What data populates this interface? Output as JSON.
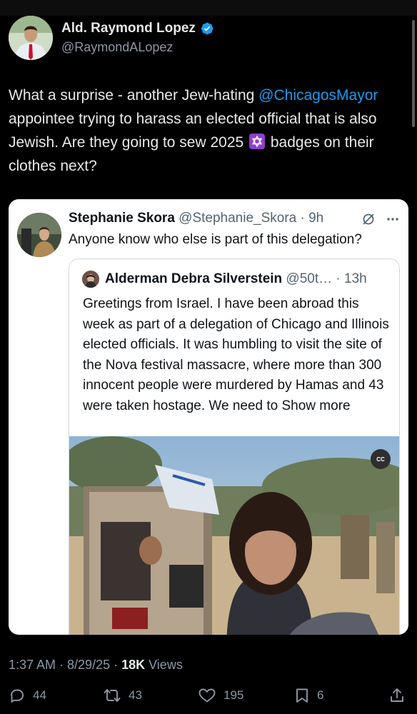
{
  "tweet": {
    "author": {
      "display_name": "Ald. Raymond Lopez",
      "handle": "@RaymondALopez",
      "verified": true
    },
    "text_before": "What a surprise - another Jew-hating ",
    "mention": "@ChicagosMayor",
    "text_after": " appointee trying to harass an elected official that is also Jewish. Are they going to sew 2025 ",
    "emoji": "star-of-david-emoji",
    "text_end": " badges on their clothes next?",
    "timestamp": "1:37 AM · 8/29/25 · ",
    "views_count": "18K",
    "views_label": " Views"
  },
  "quote": {
    "display_name": "Stephanie Skora",
    "meta": " @Stephanie_Skora · 9h",
    "text": "Anyone know who else is part of this delegation?",
    "nested": {
      "display_name": "Alderman Debra Silverstein",
      "meta": " @50t… · 13h",
      "text": "Greetings from Israel. I have been abroad this week as part of a delegation of Chicago and Illinois elected officials. It was humbling to visit the site of the Nova festival massacre, where more than 300 innocent people were murdered by Hamas and 43 were taken hostage. We need to ",
      "show_more": "Show more",
      "video_badge": "CC"
    }
  },
  "actions": {
    "replies": "44",
    "reposts": "43",
    "likes": "195",
    "bookmarks": "6"
  },
  "colors": {
    "accent": "#1d9bf0",
    "background": "#000000",
    "secondary_text": "#8b98a5",
    "emoji_purple": "#8e3fc9"
  }
}
